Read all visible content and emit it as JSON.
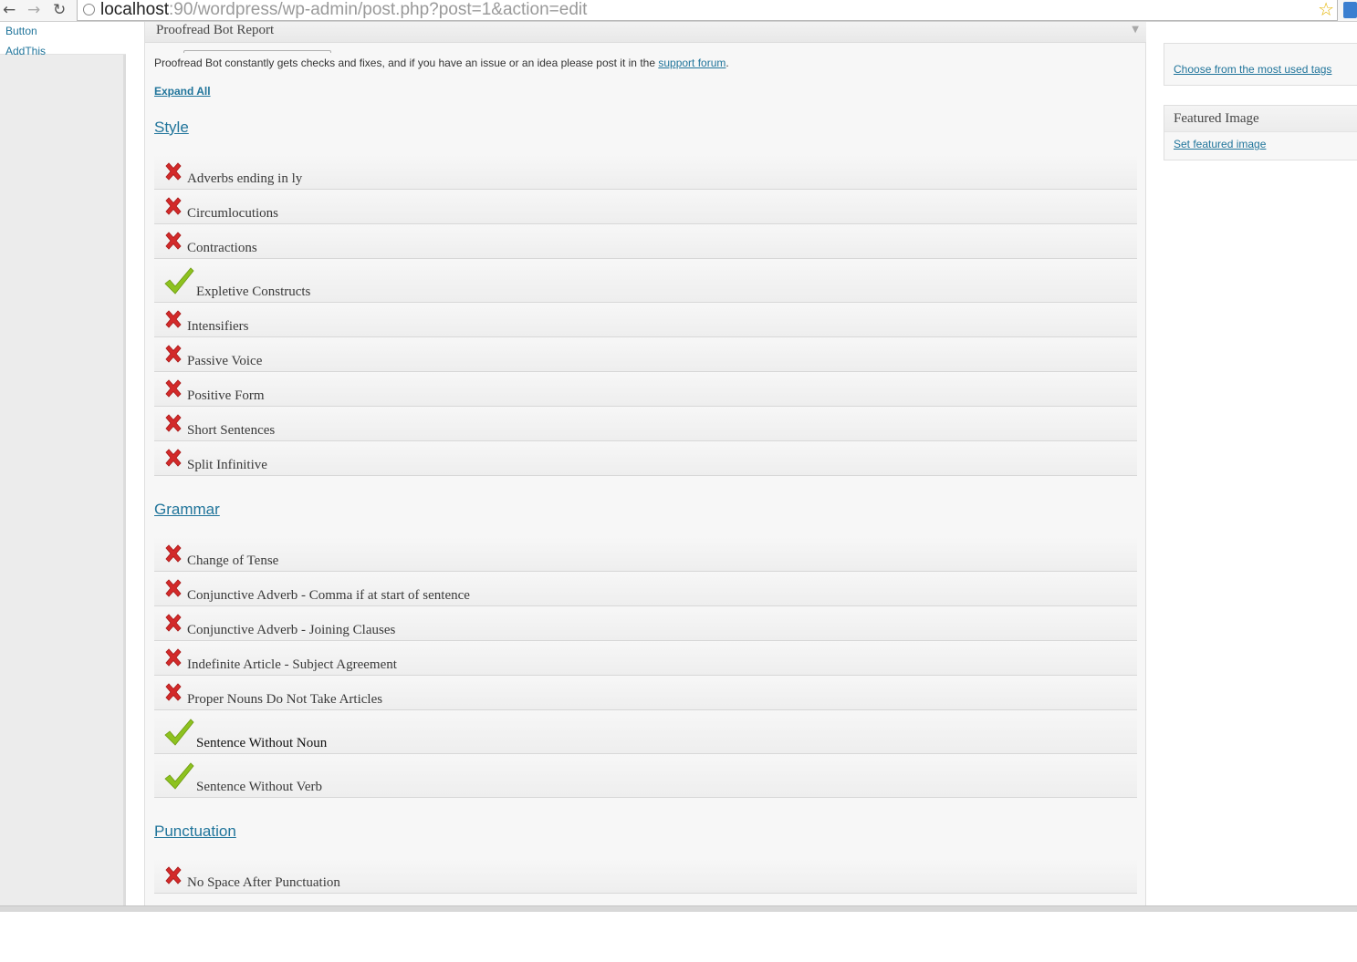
{
  "browser": {
    "url_host": "localhost",
    "url_rest": ":90/wordpress/wp-admin/post.php?post=1&action=edit",
    "back_glyph": "←",
    "forward_glyph": "→",
    "reload_glyph": "↻",
    "star_glyph": "☆"
  },
  "admin_menu": {
    "items": [
      {
        "label": "Button"
      },
      {
        "label": "AddThis"
      }
    ]
  },
  "report": {
    "title": "Proofread Bot Report",
    "toggle_glyph": "▼",
    "intro_text": "Proofread Bot constantly gets checks and fixes, and if you have an issue or an idea please post it in the ",
    "intro_link": "support forum",
    "intro_end": ".",
    "expand_all": "Expand All",
    "sections": [
      {
        "heading": "Style",
        "items": [
          {
            "label": "Adverbs ending in ly",
            "status": "fail"
          },
          {
            "label": "Circumlocutions",
            "status": "fail"
          },
          {
            "label": "Contractions",
            "status": "fail"
          },
          {
            "label": "Expletive Constructs",
            "status": "pass"
          },
          {
            "label": "Intensifiers",
            "status": "fail"
          },
          {
            "label": "Passive Voice",
            "status": "fail"
          },
          {
            "label": "Positive Form",
            "status": "fail"
          },
          {
            "label": "Short Sentences",
            "status": "fail"
          },
          {
            "label": "Split Infinitive",
            "status": "fail"
          }
        ]
      },
      {
        "heading": "Grammar",
        "items": [
          {
            "label": "Change of Tense",
            "status": "fail"
          },
          {
            "label": "Conjunctive Adverb - Comma if at start of sentence",
            "status": "fail"
          },
          {
            "label": "Conjunctive Adverb - Joining Clauses",
            "status": "fail"
          },
          {
            "label": "Indefinite Article - Subject Agreement",
            "status": "fail"
          },
          {
            "label": "Proper Nouns Do Not Take Articles",
            "status": "fail"
          },
          {
            "label": "Sentence Without Noun",
            "status": "pass"
          },
          {
            "label": "Sentence Without Verb",
            "status": "pass"
          }
        ]
      },
      {
        "heading": "Punctuation",
        "items": [
          {
            "label": "No Space After Punctuation",
            "status": "fail"
          }
        ]
      }
    ]
  },
  "sidebar": {
    "tags_link": "Choose from the most used tags",
    "featured_title": "Featured Image",
    "featured_link": "Set featured image"
  },
  "colors": {
    "link": "#21759b",
    "fail": "#d32a2a",
    "pass": "#8dc21f"
  },
  "icons": {
    "fail": "cross-icon",
    "pass": "checkmark-icon"
  }
}
